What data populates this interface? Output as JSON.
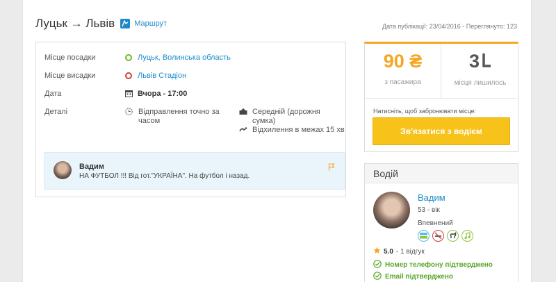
{
  "header": {
    "route_from": "Луцьк",
    "route_arrow": "→",
    "route_to": "Львів",
    "map_link": "Маршрут",
    "publication_label": "Дата публікації:",
    "publication_date": "23/04/2016",
    "views_label": "Переглянуто:",
    "views_count": "123"
  },
  "details": {
    "pickup_label": "Місце посадки",
    "pickup_value": "Луцьк, Волинська область",
    "dropoff_label": "Місце висадки",
    "dropoff_value": "Львів Стадіон",
    "date_label": "Дата",
    "date_value": "Вчора - 17:00",
    "extra_label": "Деталі",
    "departure_note": "Відправлення точно за часом",
    "luggage_note": "Середній (дорожня сумка)",
    "detour_note": "Відхилення в межах 15 хв"
  },
  "comment": {
    "author": "Вадим",
    "text": "НА ФУТБОЛ !!! Від гот.\"УКРАЇНА\". На футбол і назад."
  },
  "booking": {
    "price": "90 ₴",
    "price_caption": "з пасажира",
    "seats": "3",
    "seats_caption": "місця лишилось",
    "hint": "Натисніть, щоб забронювати місце:",
    "contact_button": "Зв'язатися з водієм"
  },
  "driver": {
    "section_title": "Водій",
    "name": "Вадим",
    "age": "53 - вік",
    "experience": "Впевнений",
    "preferences": [
      "blabla-icon",
      "no-smoking-icon",
      "no-pets-icon",
      "music-icon"
    ],
    "rating": "5.0",
    "reviews": "- 1 відгук",
    "phone_verified": "Номер телефону підтверджено",
    "email_verified": "Email підтверджено"
  },
  "colors": {
    "accent": "#f5a623",
    "link": "#1a8dc9",
    "button": "#f7c21a",
    "verified": "#5aa62a"
  }
}
